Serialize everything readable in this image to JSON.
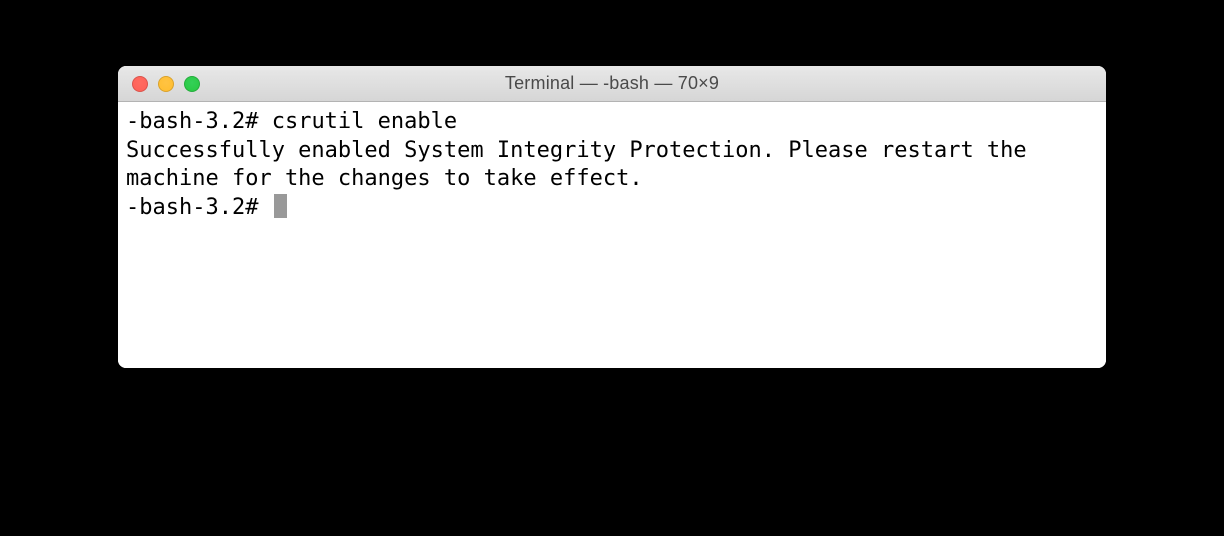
{
  "window": {
    "title": "Terminal — -bash — 70×9"
  },
  "terminal": {
    "line1_prompt": "-bash-3.2# ",
    "line1_command": "csrutil enable",
    "output": "Successfully enabled System Integrity Protection. Please restart the machine for the changes to take effect.",
    "line2_prompt": "-bash-3.2# "
  }
}
